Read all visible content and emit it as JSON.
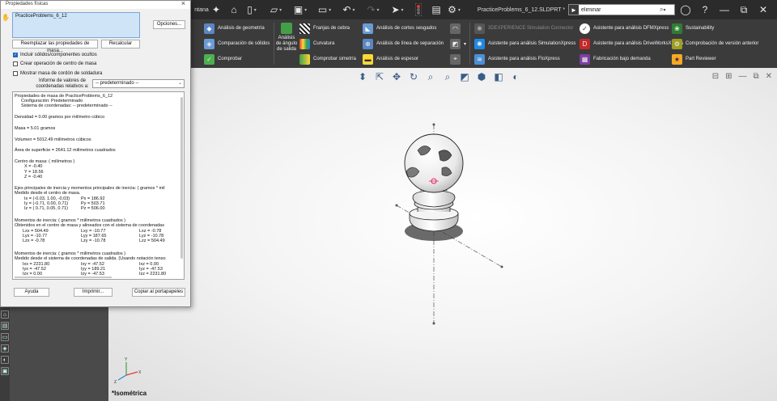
{
  "titlebar": {
    "left_fragment": "ntana",
    "doc_title": "PracticeProblems_6_12.SLDPRT *",
    "search_value": "eliminar",
    "search_prefix": "►",
    "icons": [
      "pin-icon",
      "home-icon",
      "new-document-icon",
      "open-icon",
      "save-icon",
      "print-icon",
      "undo-icon",
      "redo-icon",
      "select-arrow-icon",
      "traffic-light-icon",
      "file-properties-icon",
      "options-gear-icon",
      "search-icon",
      "user-icon",
      "help-icon",
      "minimize-icon",
      "restore-icon",
      "close-icon"
    ]
  },
  "ribbon": {
    "col1": [
      "Análisis de geometría",
      "Comparación de sólidos",
      "Comprobar"
    ],
    "angle_analysis": "Análisis de ángulo de salida",
    "col2": [
      "Franjas de cebra",
      "Curvatura",
      "Comprobar simetría"
    ],
    "col3": [
      "Análisis de cortes sesgados",
      "Análisis de línea de separación",
      "Análisis de espesor"
    ],
    "col4": [
      "3DEXPERIENCE Simulation Connector",
      "Asistente para análisis SimulationXpress",
      "Asistente para análisis FloXpress"
    ],
    "col5": [
      "Asistente para análisis DFMXpress",
      "Asistente para análisis DriveWorksXpress",
      "Fabricación bajo demanda"
    ],
    "col6": [
      "Sustainability",
      "Comprobación de versión anterior",
      "Part Reviewer"
    ]
  },
  "dialog": {
    "title": "Propiedades físicas",
    "selection": "PracticeProblems_6_12",
    "options_button": "Opciones...",
    "replace_button": "Reemplazar las propiedades de masa...",
    "recalc_button": "Recalcular",
    "checkboxes": [
      {
        "label": "Incluir sólidos/componentes ocultos",
        "checked": true
      },
      {
        "label": "Crear operación de centro de masa",
        "checked": false
      },
      {
        "label": "Mostrar masa de cordón de soldadura",
        "checked": false
      }
    ],
    "coord_label": "Informe de valores de coordenadas relativos a:",
    "coord_value": "-- predeterminado --",
    "results": {
      "header": [
        "Propiedades de masa de PracticeProblems_6_12",
        "Configuración:  Predeterminado",
        "Sistema de coordenadas:  -- predeterminado --"
      ],
      "density": "Densidad = 0.00 gramos por milímetro cúbico",
      "mass": "Masa = 5.01 gramos",
      "volume": "Volumen = 5012.49 milímetros cúbicos",
      "area": "Área de superficie = 2641.12  milímetros cuadrados",
      "com_title": "Centro de masa: ( milímetros )",
      "com": [
        "X = -0.40",
        "Y = 18.56",
        "Z = -0.40"
      ],
      "principal_title": "Ejes principales de inercia y momentos principales de inercia: ( gramos *  mil",
      "principal_sub": "Medido desde el centro de masa.",
      "principal_axes": [
        "Ix = (-0.03,  1.00, -0.03)",
        "Iy = (-0.71,  0.00,  0.71)",
        "Iz = ( 0.71,  0.05,  0.71)"
      ],
      "principal_moments": [
        "Px = 186.92",
        "Py = 503.71",
        "Pz = 506.00"
      ],
      "moments_com_title": "Momentos de inercia: ( gramos *  milímetros cuadrados )",
      "moments_com_sub": "Obtenidos en el centro de masa y alineados con el sistema de coordenadas",
      "moments_com": [
        [
          "Lxx = 504.49",
          "Lxy = -10.77",
          "Lxz = -0.78"
        ],
        [
          "Lyx = -10.77",
          "Lyy = 187.65",
          "Lyz = -10.78"
        ],
        [
          "Lzx = -0.78",
          "Lzy = -10.78",
          "Lzz = 504.49"
        ]
      ],
      "moments_out_title": "Momentos de inercia: ( gramos *  milímetros cuadrados )",
      "moments_out_sub": "Medido desde el sistema de coordenadas de salida. (Usando notación tenso",
      "moments_out": [
        [
          "Ixx = 2231.80",
          "Ixy = -47.52",
          "Ixz = 0.00"
        ],
        [
          "Iyx = -47.52",
          "Iyy = 189.21",
          "Iyz = -47.53"
        ],
        [
          "Izx = 0.00",
          "Izy = -47.53",
          "Izz = 2231.80"
        ]
      ]
    },
    "help_button": "Ayuda",
    "print_button": "Imprimir...",
    "copy_button": "Copiar al portapapeles"
  },
  "viewport": {
    "view_label": "*Isométrica"
  }
}
